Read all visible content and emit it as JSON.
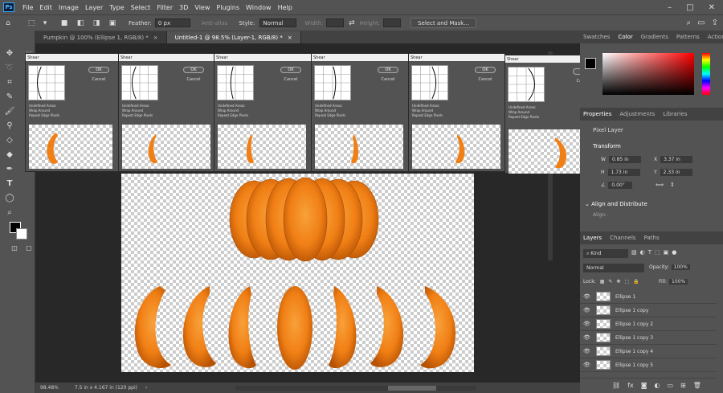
{
  "menubar": {
    "logo": "Ps",
    "items": [
      "File",
      "Edit",
      "Image",
      "Layer",
      "Type",
      "Select",
      "Filter",
      "3D",
      "View",
      "Plugins",
      "Window",
      "Help"
    ],
    "window_buttons": [
      "–",
      "□",
      "✕"
    ]
  },
  "options": {
    "feather_label": "Feather:",
    "feather_value": "0 px",
    "anti_alias": "Anti-alias",
    "style_label": "Style:",
    "style_value": "Normal",
    "width_label": "Width:",
    "height_label": "Height:",
    "select_mask": "Select and Mask..."
  },
  "tabs": [
    {
      "label": "Pumpkin @ 100% (Ellipse 1, RGB/8) *",
      "active": false
    },
    {
      "label": "Untitled-1 @ 98.5% (Layer-1, RGB/8) *",
      "active": true
    }
  ],
  "dialog": {
    "title": "Shear",
    "ok": "OK",
    "cancel": "Cancel",
    "undefined_areas": "Undefined Areas:",
    "wrap_around": "Wrap Around",
    "repeat_edge": "Repeat Edge Pixels"
  },
  "status": {
    "zoom": "98.48%",
    "doc_size": "7.5 in x 4.167 in (120 ppi)"
  },
  "color_panel": {
    "tabs": [
      "Swatches",
      "Color",
      "Gradients",
      "Patterns",
      "Actions"
    ],
    "active": "Color"
  },
  "properties": {
    "tabs": [
      "Properties",
      "Adjustments",
      "Libraries"
    ],
    "type": "Pixel Layer",
    "transform_heading": "Transform",
    "w_label": "W",
    "w_value": "0.85 in",
    "x_label": "X",
    "x_value": "3.37 in",
    "h_label": "H",
    "h_value": "1.73 in",
    "y_label": "Y",
    "y_value": "2.33 in",
    "angle": "0.00°",
    "align_heading": "Align and Distribute",
    "align_label": "Align:"
  },
  "layers_panel": {
    "tabs": [
      "Layers",
      "Channels",
      "Paths"
    ],
    "filter": "Kind",
    "blend_mode": "Normal",
    "opacity_label": "Opacity:",
    "opacity_value": "100%",
    "lock_label": "Lock:",
    "fill_label": "Fill:",
    "fill_value": "100%",
    "layers": [
      "Ellipse 1",
      "Ellipse 1 copy",
      "Ellipse 1 copy 2",
      "Ellipse 1 copy 3",
      "Ellipse 1 copy 4",
      "Ellipse 1 copy 5"
    ],
    "footer_icons": [
      "link-icon",
      "fx-icon",
      "mask-icon",
      "adjustment-icon",
      "folder-icon",
      "new-layer-icon",
      "trash-icon"
    ]
  },
  "colors": {
    "pumpkin": "#f28a1a",
    "pumpkin_dark": "#c25a06",
    "ui_dark": "#282828",
    "ui_panel": "#535353"
  }
}
